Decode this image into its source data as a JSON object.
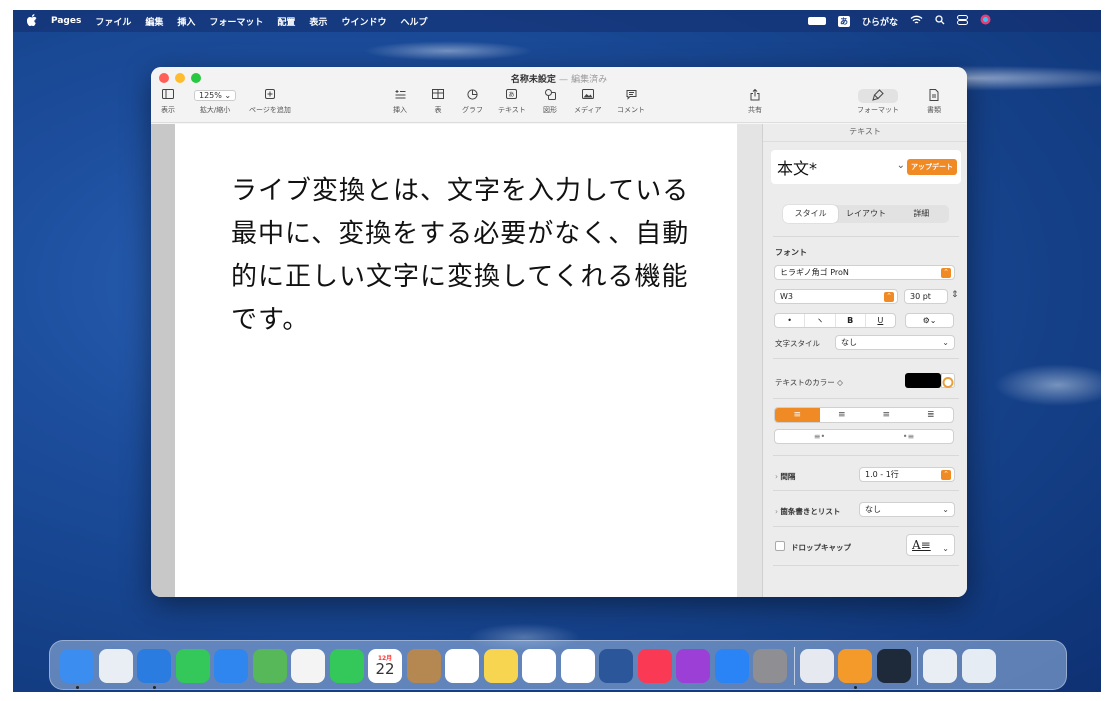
{
  "menubar": {
    "app": "Pages",
    "items": [
      "ファイル",
      "編集",
      "挿入",
      "フォーマット",
      "配置",
      "表示",
      "ウインドウ",
      "ヘルプ"
    ],
    "input_mode_box": "あ",
    "input_mode_label": "ひらがな"
  },
  "window": {
    "title": "名称未設定",
    "title_separator": "—",
    "title_status": "編集済み"
  },
  "toolbar": {
    "view_label": "表示",
    "zoom_value": "125% ⌄",
    "zoom_label": "拡大/縮小",
    "add_page_label": "ページを追加",
    "insert_label": "挿入",
    "table_label": "表",
    "chart_label": "グラフ",
    "text_label": "テキスト",
    "shape_label": "図形",
    "media_label": "メディア",
    "comment_label": "コメント",
    "share_label": "共有",
    "format_label": "フォーマット",
    "document_label": "書類"
  },
  "document": {
    "body_text": "ライブ変換とは、文字を入力している最中に、変換をする必要がなく、自動的に正しい文字に変換してくれる機能です。"
  },
  "inspector": {
    "header": "テキスト",
    "paragraph_style": "本文*",
    "update_button": "アップデート",
    "tabs": [
      "スタイル",
      "レイアウト",
      "詳細"
    ],
    "font_section": "フォント",
    "font_family": "ヒラギノ角ゴ ProN",
    "font_weight": "W3",
    "font_size": "30 pt",
    "format_buttons": [
      "•",
      "ヽ",
      "B",
      "U"
    ],
    "char_style_label": "文字スタイル",
    "char_style_value": "なし",
    "text_color_label": "テキストのカラー ◇",
    "text_color": "#000000",
    "spacing_label": "間隔",
    "spacing_value": "1.0 - 1行",
    "bullets_label": "箇条書きとリスト",
    "bullets_value": "なし",
    "dropcap_label": "ドロップキャップ"
  },
  "dock": {
    "apps": [
      {
        "name": "finder",
        "color": "#3b8df0"
      },
      {
        "name": "launchpad",
        "color": "#e9eef5"
      },
      {
        "name": "safari",
        "color": "#2a7ce0"
      },
      {
        "name": "messages",
        "color": "#34c759"
      },
      {
        "name": "mail",
        "color": "#2f86ef"
      },
      {
        "name": "maps",
        "color": "#57b85a"
      },
      {
        "name": "photos",
        "color": "#f4f4f4"
      },
      {
        "name": "facetime",
        "color": "#34c759"
      },
      {
        "name": "calendar",
        "color": "#ffffff"
      },
      {
        "name": "contacts",
        "color": "#b58852"
      },
      {
        "name": "reminders",
        "color": "#ffffff"
      },
      {
        "name": "notes",
        "color": "#f7d551"
      },
      {
        "name": "freeform",
        "color": "#ffffff"
      },
      {
        "name": "chrome",
        "color": "#ffffff"
      },
      {
        "name": "word",
        "color": "#2b579a"
      },
      {
        "name": "music",
        "color": "#fa3a55"
      },
      {
        "name": "podcasts",
        "color": "#9b3fd6"
      },
      {
        "name": "app-store",
        "color": "#2a84f5"
      },
      {
        "name": "system-settings",
        "color": "#8e8e93"
      },
      {
        "name": "preview",
        "color": "#e6eaf0"
      },
      {
        "name": "pages",
        "color": "#f49a2a"
      },
      {
        "name": "quicktime",
        "color": "#1e2a3a"
      },
      {
        "name": "downloads",
        "color": "#e9eef5"
      },
      {
        "name": "trash",
        "color": "#e6ecf3"
      }
    ],
    "calendar_month": "12月",
    "calendar_day": "22"
  }
}
